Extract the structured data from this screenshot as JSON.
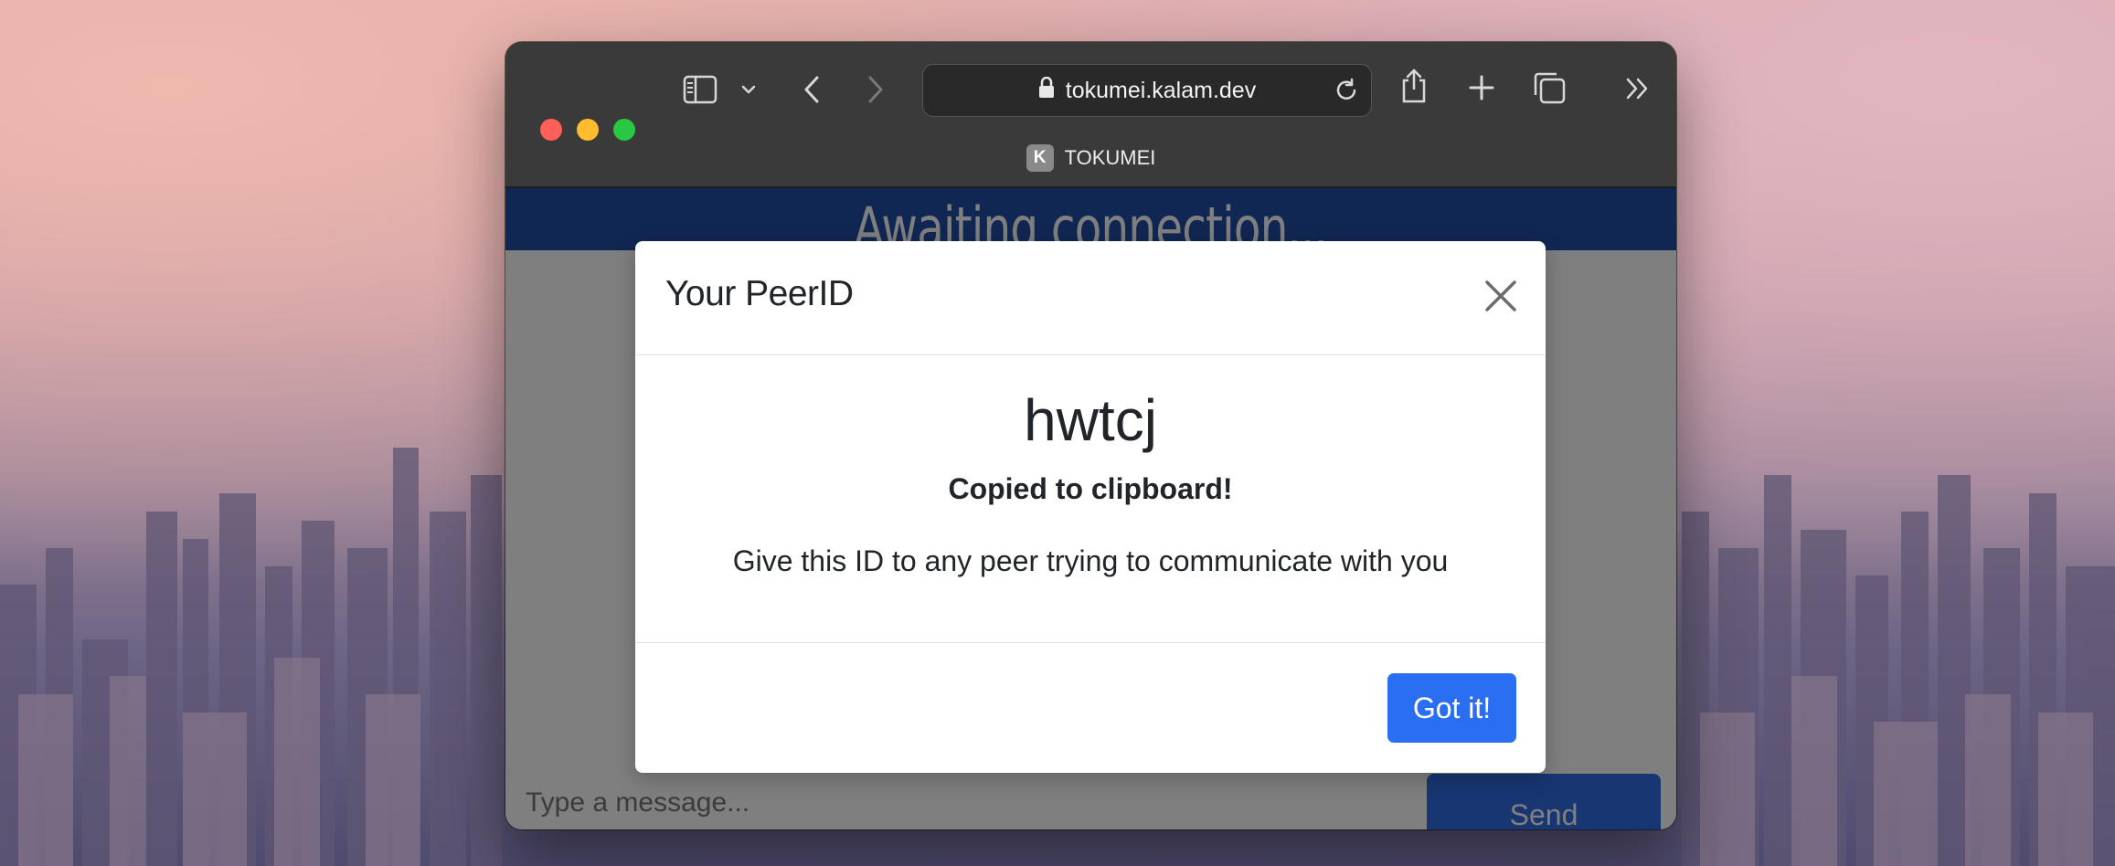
{
  "browser": {
    "url": "tokumei.kalam.dev",
    "tab_title": "TOKUMEI",
    "favicon_letter": "K",
    "icons": [
      "sidebar-icon",
      "chevron-down-icon",
      "back-icon",
      "forward-icon",
      "lock-icon",
      "reload-icon",
      "share-icon",
      "new-tab-icon",
      "tab-overview-icon",
      "more-chevrons-icon"
    ]
  },
  "page": {
    "banner_text": "Awaiting connection...",
    "message_placeholder": "Type a message...",
    "send_label": "Send"
  },
  "modal": {
    "title": "Your PeerID",
    "peer_id": "hwtcj",
    "copied_text": "Copied to clipboard!",
    "hint": "Give this ID to any peer trying to communicate with you",
    "confirm_label": "Got it!"
  },
  "colors": {
    "banner": "#234fa7",
    "primary_button": "#2a6ff2",
    "traffic_red": "#fe5f57",
    "traffic_yellow": "#febc2e",
    "traffic_green": "#28c840"
  }
}
